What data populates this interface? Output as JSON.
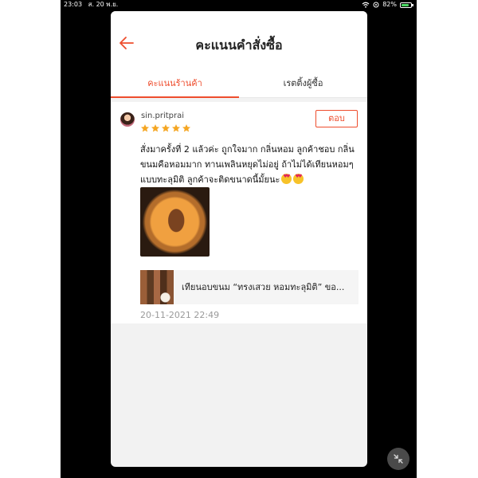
{
  "status_bar": {
    "time": "23:03",
    "date": "ส. 20 พ.ย.",
    "battery": "82%",
    "battery_level": 0.82
  },
  "header": {
    "title": "คะแนนคำสั่งซื้อ"
  },
  "tabs": [
    {
      "label": "คะแนนร้านค้า",
      "active": true
    },
    {
      "label": "เรตติ้งผู้ซื้อ",
      "active": false
    }
  ],
  "review": {
    "username": "sin.pritprai",
    "rating": 5,
    "reply_label": "ตอบ",
    "comment": "สั่งมาครั้งที่ 2 แล้วค่ะ ถูกใจมาก กลิ่นหอม ลูกค้าชอบ กลิ่นขนมคือหอมมาก ทานเพลินหยุดไม่อยู่ ถ้าไม่ได้เทียนหอมๆแบบทะลุมิติ ลูกค้าจะติดขนาดนี้มั้ยนะ",
    "emoji_name": "heart-eyes-emoji",
    "product_name": "เทียนอบขนม “ทรงเสวย หอมทะลุมิติ” ขอ...",
    "timestamp": "20-11-2021 22:49"
  },
  "colors": {
    "accent": "#ee4d2d",
    "star": "#f5a623",
    "background": "#f2f2f2"
  }
}
